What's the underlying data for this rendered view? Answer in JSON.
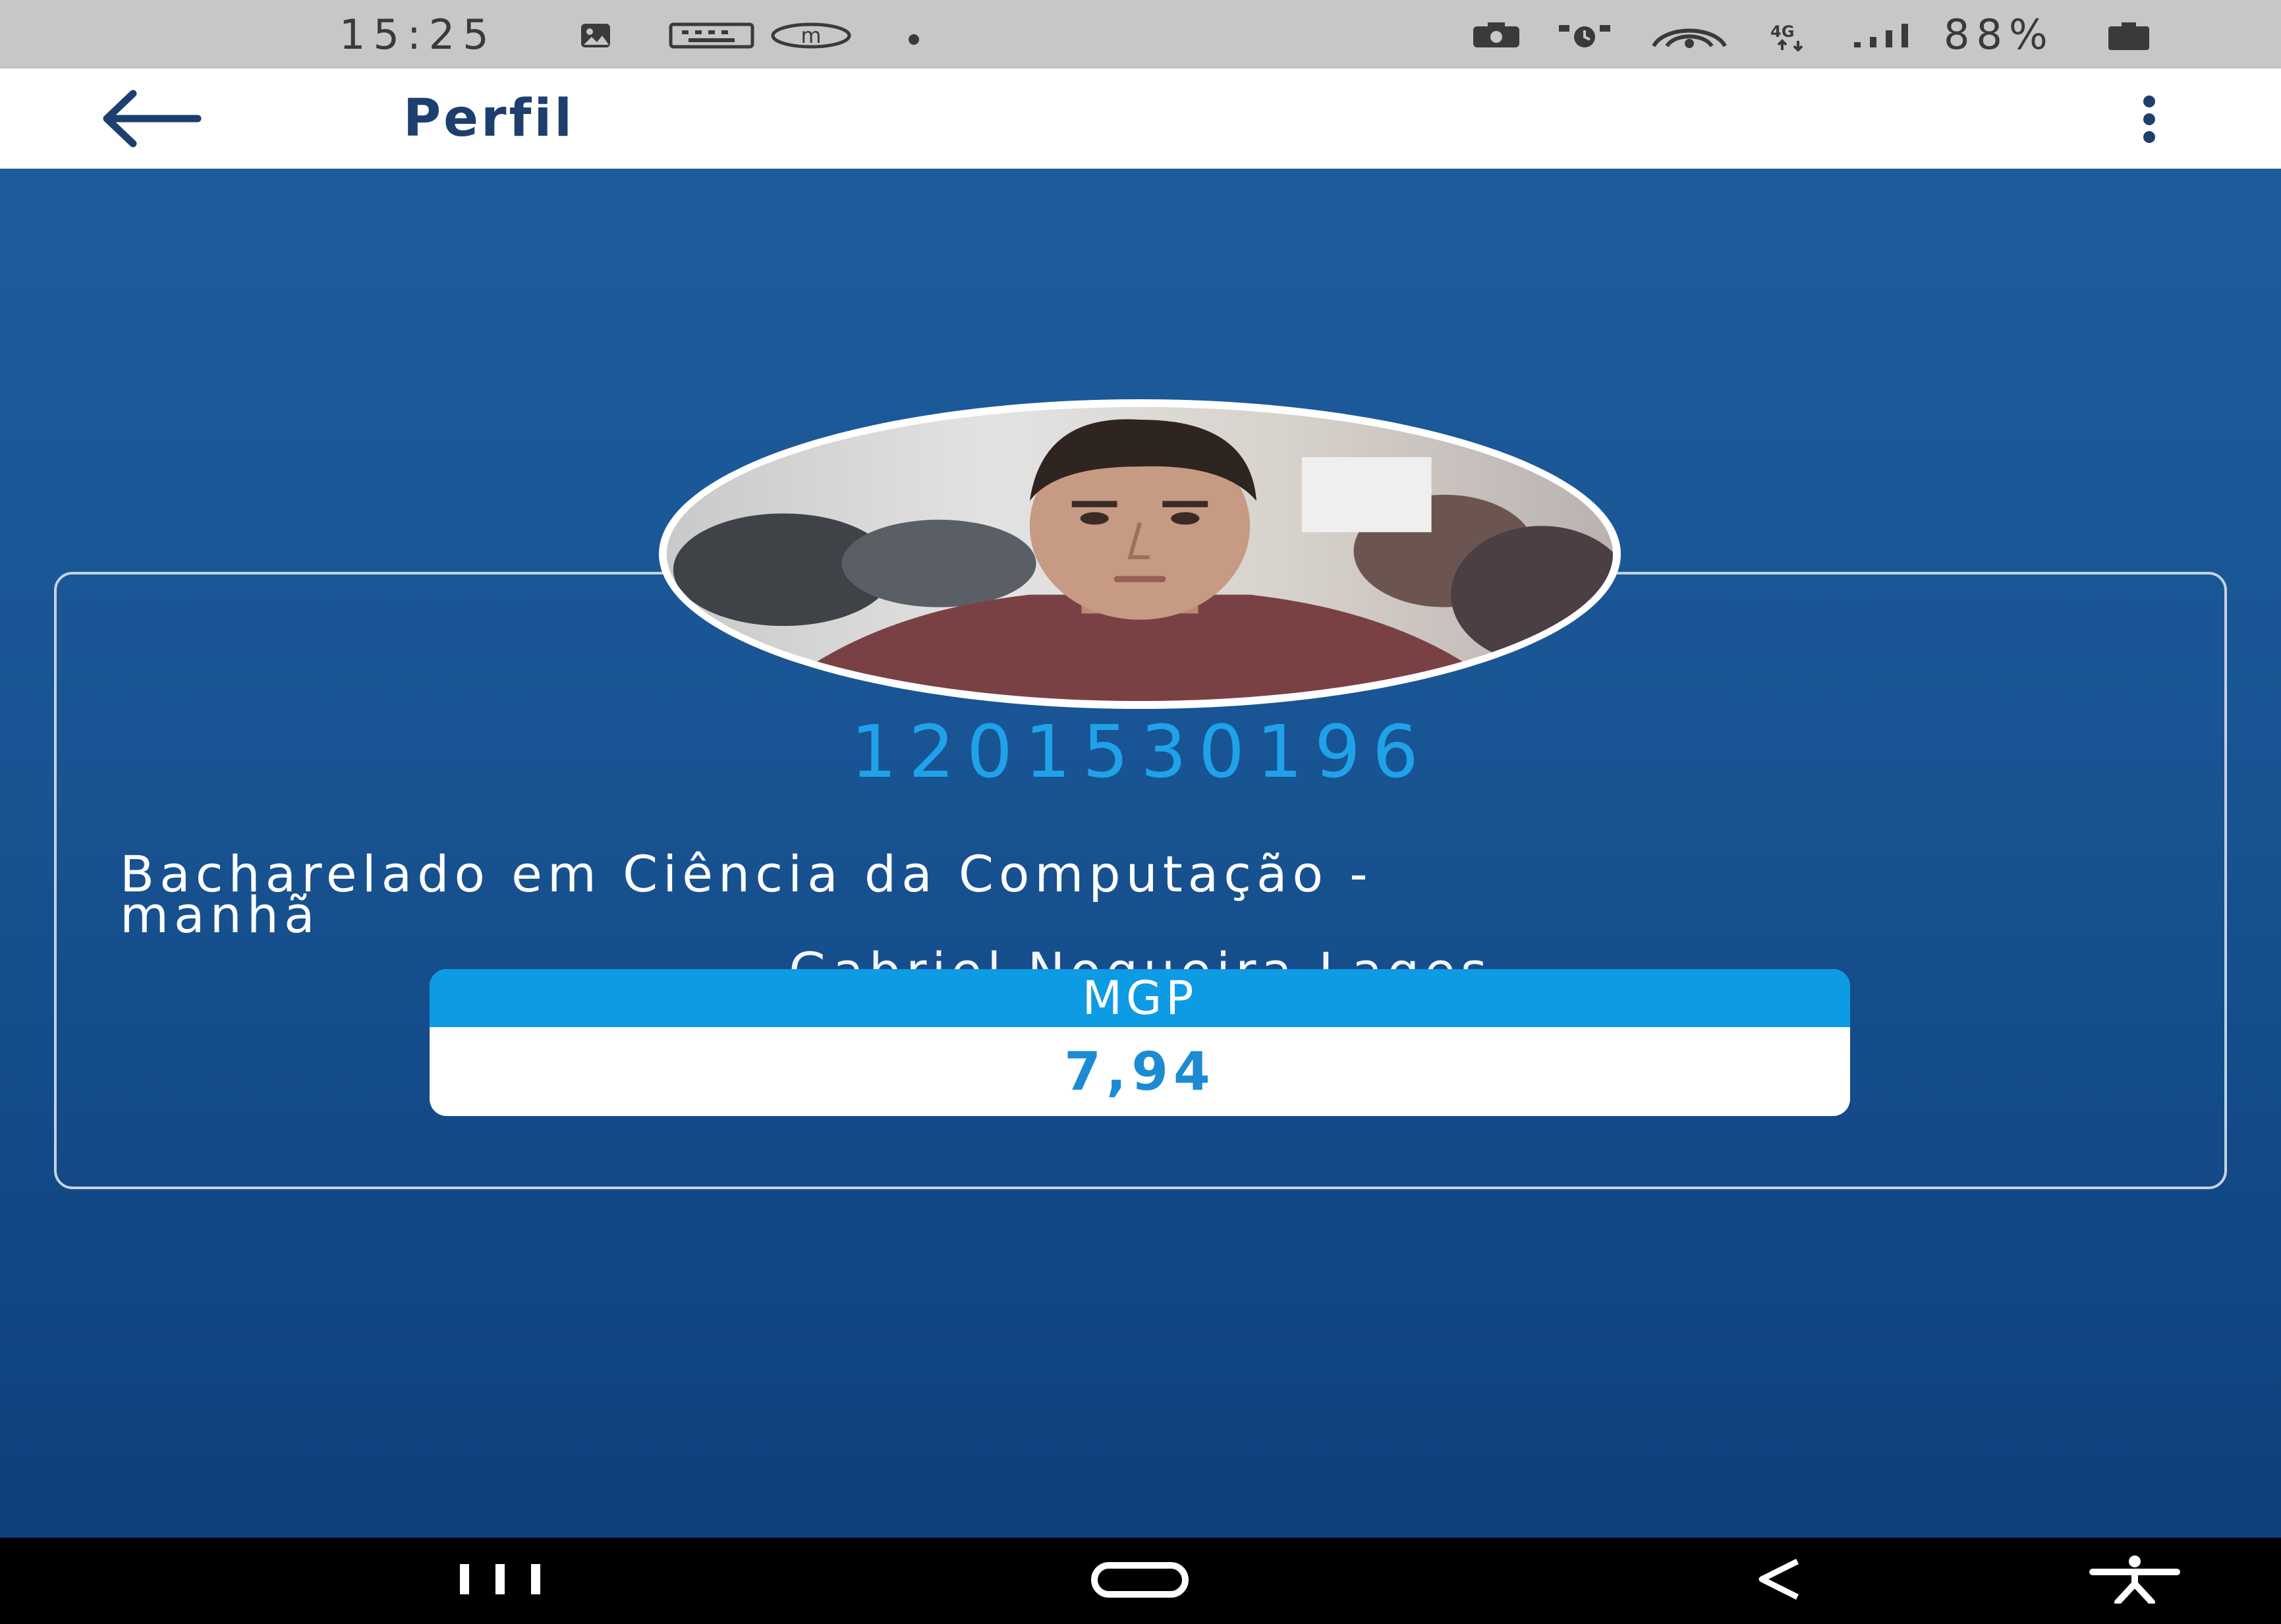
{
  "status_bar": {
    "time": "15:25",
    "battery": "88%",
    "left_icons": [
      "gallery-icon",
      "keyboard-icon",
      "m-app-icon",
      "dot-icon"
    ],
    "right_icons": [
      "camera-icon",
      "alarm-icon",
      "hotspot-icon",
      "4g-icon",
      "signal-icon",
      "battery-icon"
    ]
  },
  "app_bar": {
    "title": "Perfil",
    "back_icon": "arrow-left-icon",
    "menu_icon": "more-vertical-icon"
  },
  "profile": {
    "student_id": "1201530196",
    "name": "Gabriel Nogueira Lages",
    "course_line1": "Bacharelado em Ciência da Computação -",
    "course_line2": "manhã",
    "mgp_label": "MGP",
    "mgp_value": "7,94"
  },
  "colors": {
    "app_bg_top": "#1e5c9c",
    "app_bg_bottom": "#0f3f7d",
    "accent": "#0d9be4",
    "id_color": "#1fa2ea",
    "title_color": "#1d3f6e"
  },
  "nav_bar": {
    "icons": [
      "recent-apps-icon",
      "home-icon",
      "back-icon",
      "accessibility-icon"
    ]
  }
}
